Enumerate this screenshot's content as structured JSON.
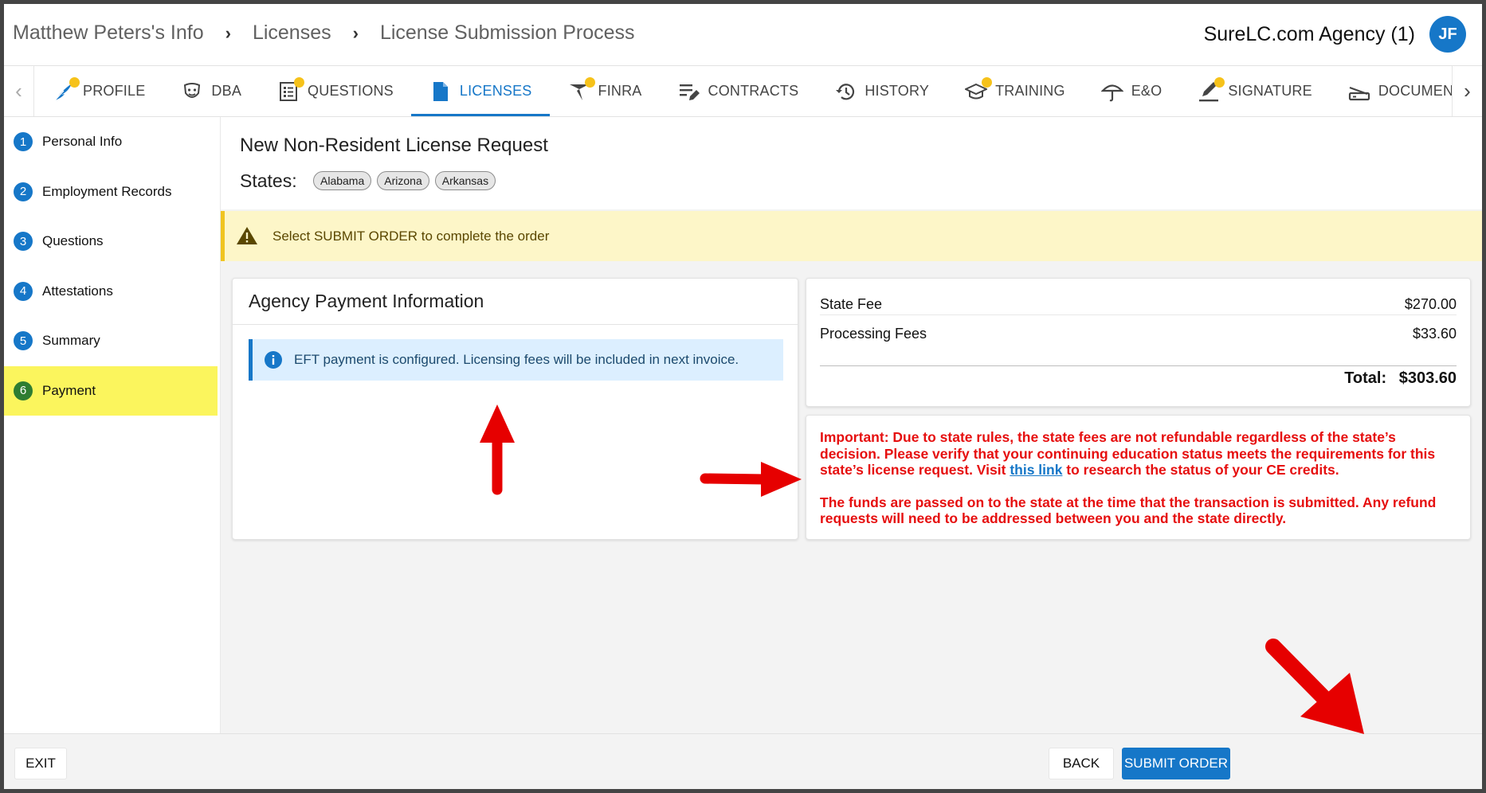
{
  "header": {
    "breadcrumbs": [
      "Matthew Peters's Info",
      "Licenses",
      "License Submission Process"
    ],
    "agency": "SureLC.com Agency (1)",
    "avatar_initials": "JF"
  },
  "tabs": [
    {
      "label": "PROFILE",
      "icon": "feather-icon",
      "dot": true,
      "active": false
    },
    {
      "label": "DBA",
      "icon": "mask-icon",
      "dot": false,
      "active": false
    },
    {
      "label": "QUESTIONS",
      "icon": "checklist-icon",
      "dot": true,
      "active": false
    },
    {
      "label": "LICENSES",
      "icon": "document-icon",
      "dot": false,
      "active": true
    },
    {
      "label": "FINRA",
      "icon": "finra-icon",
      "dot": true,
      "active": false
    },
    {
      "label": "CONTRACTS",
      "icon": "edit-lines-icon",
      "dot": false,
      "active": false
    },
    {
      "label": "HISTORY",
      "icon": "history-icon",
      "dot": false,
      "active": false
    },
    {
      "label": "TRAINING",
      "icon": "graduation-cap-icon",
      "dot": true,
      "active": false
    },
    {
      "label": "E&O",
      "icon": "umbrella-icon",
      "dot": false,
      "active": false
    },
    {
      "label": "SIGNATURE",
      "icon": "signature-pen-icon",
      "dot": true,
      "active": false
    },
    {
      "label": "DOCUMENTS",
      "icon": "scanner-icon",
      "dot": false,
      "active": false
    }
  ],
  "steps": [
    {
      "num": "1",
      "label": "Personal Info"
    },
    {
      "num": "2",
      "label": "Employment Records"
    },
    {
      "num": "3",
      "label": "Questions"
    },
    {
      "num": "4",
      "label": "Attestations"
    },
    {
      "num": "5",
      "label": "Summary"
    },
    {
      "num": "6",
      "label": "Payment"
    }
  ],
  "active_step": "6",
  "request": {
    "title": "New Non-Resident License Request",
    "states_label": "States:",
    "states": [
      "Alabama",
      "Arizona",
      "Arkansas"
    ]
  },
  "warning": {
    "text": "Select SUBMIT ORDER to complete the order"
  },
  "payment": {
    "title": "Agency Payment Information",
    "info": "EFT payment is configured. Licensing fees will be included in next invoice."
  },
  "fees": {
    "state_fee_label": "State Fee",
    "state_fee_value": "$270.00",
    "processing_label": "Processing Fees",
    "processing_value": "$33.60",
    "total_label": "Total:",
    "total_value": "$303.60"
  },
  "notice": {
    "p1_before": "Important: Due to state rules, the state fees are not refundable regardless of the state’s decision. Please verify that your continuing education status meets the requirements for this state’s license request. Visit ",
    "link": "this link",
    "p1_after": " to research the status of your CE credits.",
    "p2": "The funds are passed on to the state at the time that the transaction is submitted. Any refund requests will need to be addressed between you and the state directly."
  },
  "footer": {
    "exit": "EXIT",
    "back": "BACK",
    "submit": "SUBMIT ORDER"
  },
  "colors": {
    "primary": "#1677c8",
    "active_step_bg": "#fbf55d",
    "active_step_num": "#2e7d32",
    "warning_bg": "#fdf6c8",
    "notice_red": "#e60f0f",
    "annotation_arrow": "#e60000",
    "tab_dot": "#f6c21a"
  }
}
